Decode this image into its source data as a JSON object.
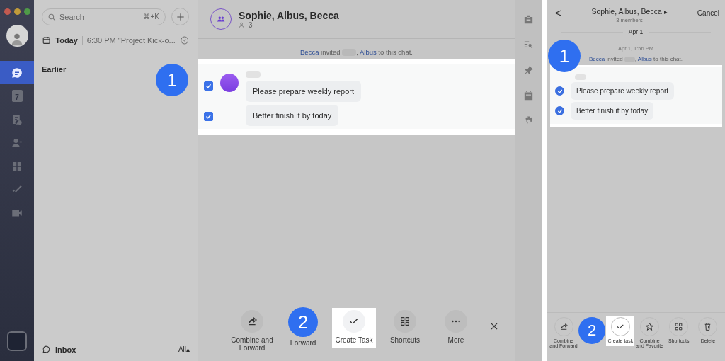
{
  "nav": {
    "items": [
      {
        "selected": true
      },
      {
        "selected": false
      },
      {
        "selected": false
      },
      {
        "selected": false
      },
      {
        "selected": false
      },
      {
        "selected": false
      },
      {
        "selected": false
      }
    ]
  },
  "calendar_day": "7",
  "list": {
    "search": {
      "placeholder": "Search",
      "shortcut": "⌘+K"
    },
    "today": {
      "label": "Today",
      "event": "6:30 PM \"Project Kick-o..."
    },
    "section": "Earlier",
    "footer": {
      "label": "Inbox",
      "filter": "All▴"
    }
  },
  "chat": {
    "title": "Sophie, Albus, Becca",
    "members": "3",
    "system": {
      "inviter": "Becca",
      "verb": "invited",
      "separator": ",",
      "invitee": "Albus",
      "rest": "to this chat."
    },
    "messages": [
      {
        "text": "Please prepare weekly report",
        "checked": true
      },
      {
        "text": "Better finish it by today",
        "checked": true
      }
    ],
    "actions": [
      {
        "kind": "forward",
        "label": "Combine and Forward",
        "highlighted": false
      },
      {
        "kind": "covered",
        "label": "Forward",
        "highlighted": false
      },
      {
        "kind": "task",
        "label": "Create Task",
        "highlighted": true
      },
      {
        "kind": "grid",
        "label": "Shortcuts",
        "highlighted": false
      },
      {
        "kind": "more",
        "label": "More",
        "highlighted": false
      }
    ]
  },
  "mobile": {
    "back": "<",
    "title": "Sophie, Albus, Becca",
    "title_glyph": "▸",
    "subtitle": "3 members",
    "cancel": "Cancel",
    "date": "Apr 1",
    "time": "Apr 1, 1:56 PM",
    "system": {
      "inviter": "Becca",
      "verb": "invited",
      "separator": ",",
      "invitee": "Albus",
      "rest": "to this chat."
    },
    "messages": [
      {
        "text": "Please prepare weekly report",
        "checked": true
      },
      {
        "text": "Better finish it by today",
        "checked": true
      }
    ],
    "actions": [
      {
        "kind": "forward",
        "label": "Combine and Forward",
        "highlighted": false
      },
      {
        "kind": "task",
        "label": "Create task",
        "highlighted": true
      },
      {
        "kind": "star",
        "label": "Combine and Favorite",
        "highlighted": false
      },
      {
        "kind": "grid",
        "label": "Shortcuts",
        "highlighted": false
      },
      {
        "kind": "trash",
        "label": "Delete",
        "highlighted": false
      }
    ]
  },
  "callouts": {
    "desktop_chat": "1",
    "desktop_actions": "2",
    "mobile_chat": "1",
    "mobile_actions": "2"
  }
}
